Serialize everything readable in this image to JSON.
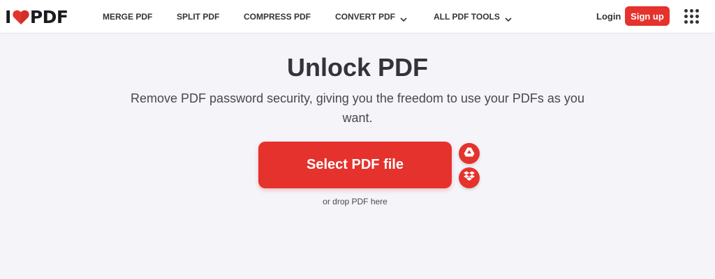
{
  "brand": {
    "logo_left": "I",
    "logo_right": "PDF",
    "accent": "#e5322d"
  },
  "nav": [
    {
      "label": "MERGE PDF",
      "dropdown": false
    },
    {
      "label": "SPLIT PDF",
      "dropdown": false
    },
    {
      "label": "COMPRESS PDF",
      "dropdown": false
    },
    {
      "label": "CONVERT PDF",
      "dropdown": true
    },
    {
      "label": "ALL PDF TOOLS",
      "dropdown": true
    }
  ],
  "auth": {
    "login": "Login",
    "signup": "Sign up"
  },
  "hero": {
    "title": "Unlock PDF",
    "subtitle": "Remove PDF password security, giving you the freedom to use your PDFs as you want."
  },
  "upload": {
    "button_label": "Select PDF file",
    "drop_hint": "or drop PDF here",
    "cloud_sources": [
      "google-drive-icon",
      "dropbox-icon"
    ]
  }
}
